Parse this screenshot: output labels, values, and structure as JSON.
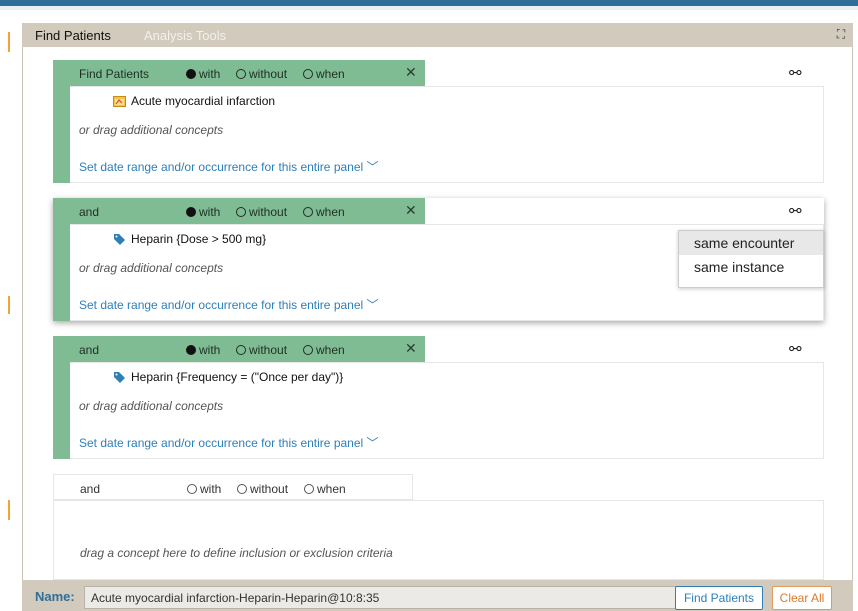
{
  "tabs": {
    "find_patients": "Find Patients",
    "analysis_tools": "Analysis Tools"
  },
  "panels": [
    {
      "operator": "Find Patients",
      "options": {
        "with": "with",
        "without": "without",
        "when": "when",
        "selected": "with"
      },
      "close": "✕",
      "concept": "Acute myocardial infarction",
      "concept_icon": "folder-icon",
      "drag_hint": "or drag additional concepts",
      "date_link": "Set date range and/or occurrence for this entire panel"
    },
    {
      "operator": "and",
      "options": {
        "with": "with",
        "without": "without",
        "when": "when",
        "selected": "with"
      },
      "close": "✕",
      "concept": "Heparin {Dose > 500 mg}",
      "concept_icon": "tag-icon",
      "drag_hint": "or drag additional concepts",
      "date_link": "Set date range and/or occurrence for this entire panel"
    },
    {
      "operator": "and",
      "options": {
        "with": "with",
        "without": "without",
        "when": "when",
        "selected": "with"
      },
      "close": "✕",
      "concept": "Heparin {Frequency = (\"Once per day\")}",
      "concept_icon": "tag-icon",
      "drag_hint": "or drag additional concepts",
      "date_link": "Set date range and/or occurrence for this entire panel"
    }
  ],
  "empty_panel": {
    "operator": "and",
    "options": {
      "with": "with",
      "without": "without",
      "when": "when"
    },
    "hint": "drag a concept here to define inclusion or exclusion criteria"
  },
  "link_dropdown": {
    "items": [
      "same encounter",
      "same instance"
    ],
    "highlighted": "same encounter"
  },
  "bottom": {
    "name_label": "Name:",
    "name_value": "Acute myocardial infarction-Heparin-Heparin@10:8:35",
    "find_button": "Find Patients",
    "clear_button": "Clear All"
  },
  "colors": {
    "accent": "#2f6f9a",
    "panel_green": "#7fbc94",
    "link_blue": "#2e7fb8",
    "tabbar": "#d1cabd",
    "clear_orange": "#d97a2b"
  }
}
